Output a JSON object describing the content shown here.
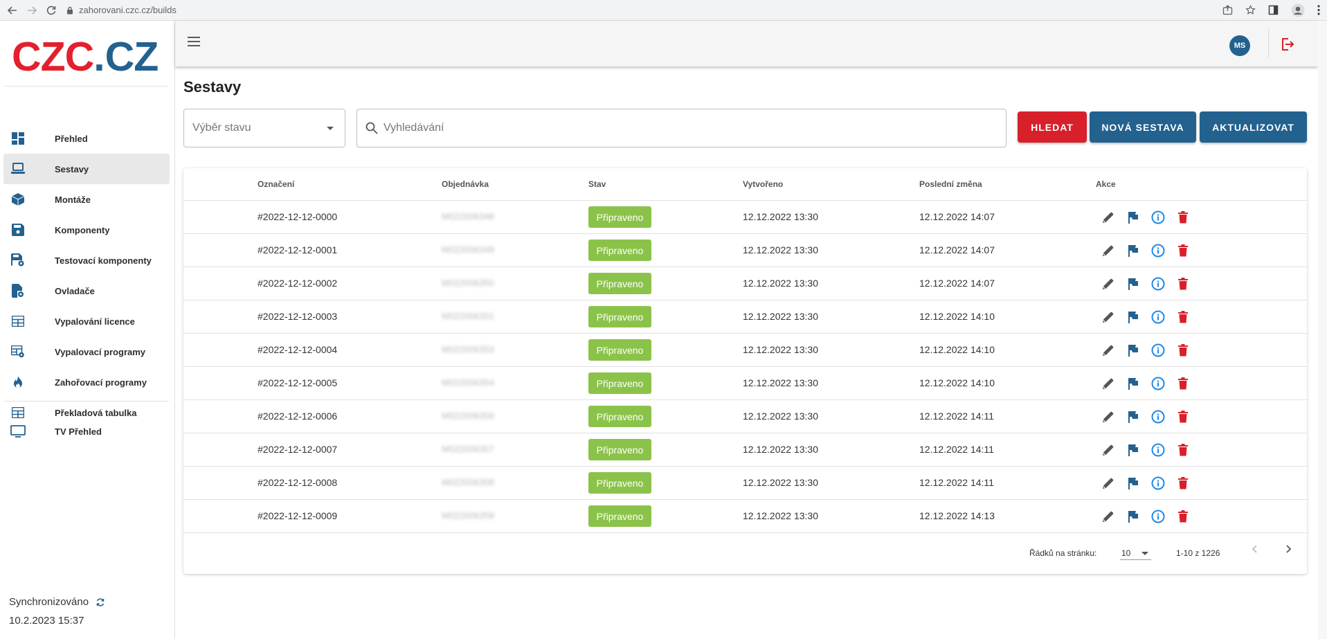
{
  "browser": {
    "url": "zahorovani.czc.cz/builds"
  },
  "logo": {
    "part1": "CZC",
    "dot": ".",
    "part2": "CZ"
  },
  "sidebar": {
    "items": [
      {
        "label": "Přehled",
        "icon": "dashboard-icon"
      },
      {
        "label": "Sestavy",
        "icon": "computer-icon"
      },
      {
        "label": "Montáže",
        "icon": "box-icon"
      },
      {
        "label": "Komponenty",
        "icon": "save-icon"
      },
      {
        "label": "Testovací komponenty",
        "icon": "test-component-icon"
      },
      {
        "label": "Ovladače",
        "icon": "driver-icon"
      },
      {
        "label": "Vypalování licence",
        "icon": "table-icon"
      },
      {
        "label": "Vypalovací programy",
        "icon": "table-settings-icon"
      },
      {
        "label": "Zahořovací programy",
        "icon": "fire-icon"
      },
      {
        "label": "Překladová tabulka",
        "icon": "table-icon"
      }
    ],
    "extra_item": {
      "label": "TV Přehled",
      "icon": "tv-icon"
    },
    "active_index": 1,
    "sync_label": "Synchronizováno",
    "sync_time": "10.2.2023 15:37"
  },
  "header": {
    "avatar_initials": "MS"
  },
  "page": {
    "title": "Sestavy",
    "status_select_placeholder": "Výběr stavu",
    "search_placeholder": "Vyhledávání",
    "buttons": {
      "search": "HLEDAT",
      "new": "NOVÁ SESTAVA",
      "refresh": "AKTUALIZOVAT"
    }
  },
  "table": {
    "columns": [
      "Označení",
      "Objednávka",
      "Stav",
      "Vytvořeno",
      "Poslední změna",
      "Akce"
    ],
    "rows": [
      {
        "id": "#2022-12-12-0000",
        "order": "M022006348",
        "status": "Připraveno",
        "created": "12.12.2022 13:30",
        "changed": "12.12.2022 14:07"
      },
      {
        "id": "#2022-12-12-0001",
        "order": "M022006349",
        "status": "Připraveno",
        "created": "12.12.2022 13:30",
        "changed": "12.12.2022 14:07"
      },
      {
        "id": "#2022-12-12-0002",
        "order": "M022006350",
        "status": "Připraveno",
        "created": "12.12.2022 13:30",
        "changed": "12.12.2022 14:07"
      },
      {
        "id": "#2022-12-12-0003",
        "order": "M022006351",
        "status": "Připraveno",
        "created": "12.12.2022 13:30",
        "changed": "12.12.2022 14:10"
      },
      {
        "id": "#2022-12-12-0004",
        "order": "M022006353",
        "status": "Připraveno",
        "created": "12.12.2022 13:30",
        "changed": "12.12.2022 14:10"
      },
      {
        "id": "#2022-12-12-0005",
        "order": "M022006354",
        "status": "Připraveno",
        "created": "12.12.2022 13:30",
        "changed": "12.12.2022 14:10"
      },
      {
        "id": "#2022-12-12-0006",
        "order": "M022006356",
        "status": "Připraveno",
        "created": "12.12.2022 13:30",
        "changed": "12.12.2022 14:11"
      },
      {
        "id": "#2022-12-12-0007",
        "order": "M022006357",
        "status": "Připraveno",
        "created": "12.12.2022 13:30",
        "changed": "12.12.2022 14:11"
      },
      {
        "id": "#2022-12-12-0008",
        "order": "M022006358",
        "status": "Připraveno",
        "created": "12.12.2022 13:30",
        "changed": "12.12.2022 14:11"
      },
      {
        "id": "#2022-12-12-0009",
        "order": "M022006359",
        "status": "Připraveno",
        "created": "12.12.2022 13:30",
        "changed": "12.12.2022 14:13"
      }
    ],
    "action_icons": [
      "edit-icon",
      "flag-icon",
      "info-icon",
      "delete-icon"
    ],
    "pagination": {
      "rows_label": "Řádků na stránku:",
      "rows_per_page": "10",
      "range": "1-10 z 1226"
    }
  },
  "colors": {
    "brand_red": "#e3202e",
    "brand_blue": "#23618f",
    "status_green": "#8bc34a",
    "danger": "#d8202a",
    "info": "#1e88e5"
  }
}
